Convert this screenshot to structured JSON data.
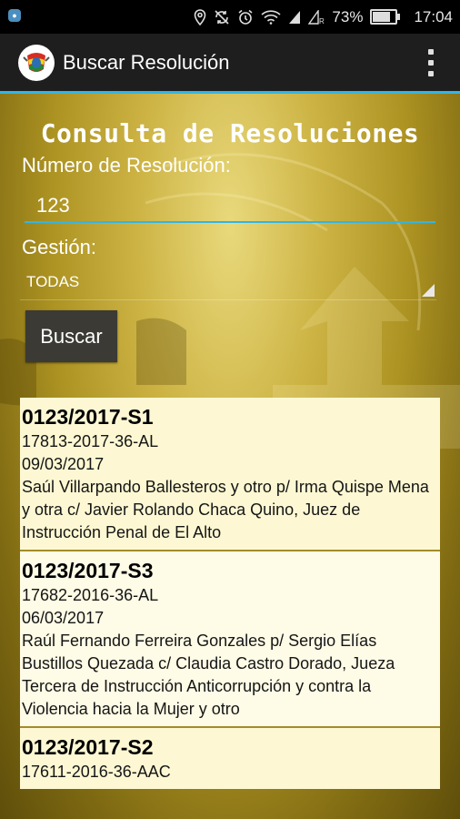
{
  "status_bar": {
    "battery": "73%",
    "time": "17:04",
    "battery_level": 0.73,
    "icons": [
      "notification-icon",
      "location-icon",
      "sync-icon",
      "alarm-icon",
      "wifi-icon",
      "signal-icon",
      "signal-r-icon",
      "battery-icon"
    ]
  },
  "action_bar": {
    "title": "Buscar Resolución",
    "logo_icon": "coat-of-arms-icon",
    "menu_icon": "overflow-menu-icon",
    "accent": "#33b5e5"
  },
  "form": {
    "heading": "Consulta de Resoluciones",
    "number_label": "Número de Resolución:",
    "number_value": "123",
    "gestion_label": "Gestión:",
    "gestion_selected": "TODAS",
    "search_button": "Buscar"
  },
  "results": [
    {
      "code": "0123/2017-S1",
      "file": "17813-2017-36-AL",
      "date": "09/03/2017",
      "description": "Saúl Villarpando Ballesteros y otro p/ Irma Quispe Mena y otra c/ Javier Rolando Chaca Quino, Juez de Instrucción Penal de El Alto"
    },
    {
      "code": "0123/2017-S3",
      "file": "17682-2016-36-AL",
      "date": "06/03/2017",
      "description": "Raúl Fernando Ferreira Gonzales p/ Sergio Elías Bustillos Quezada c/ Claudia Castro Dorado, Jueza Tercera de Instrucción Anticorrupción y contra la Violencia hacia la Mujer y otro"
    },
    {
      "code": "0123/2017-S2",
      "file": "17611-2016-36-AAC",
      "date": "",
      "description": ""
    }
  ]
}
